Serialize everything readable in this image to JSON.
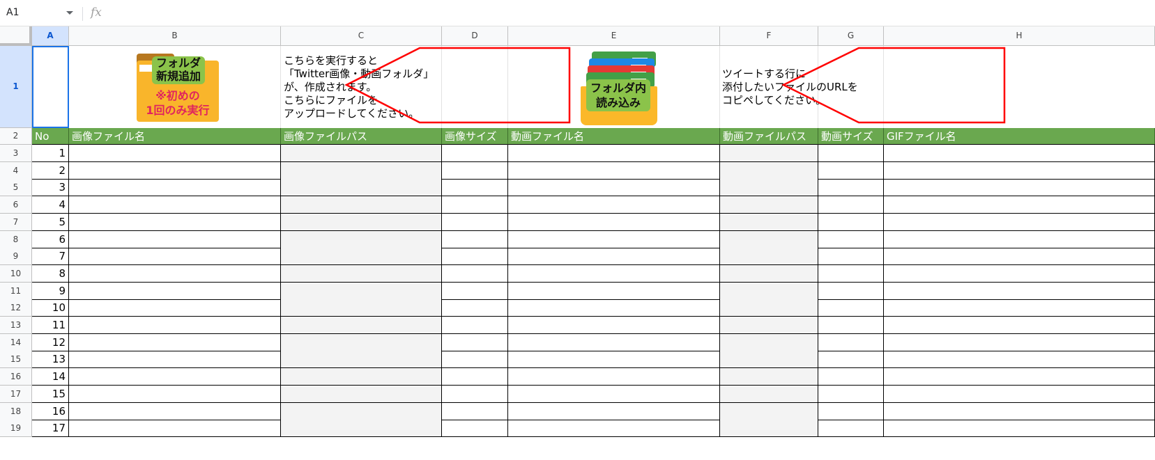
{
  "formula_bar": {
    "cell_ref": "A1",
    "fx_label": "fx"
  },
  "columns": [
    "A",
    "B",
    "C",
    "D",
    "E",
    "F",
    "G",
    "H"
  ],
  "header_row": {
    "no": "No",
    "image_file_name": "画像ファイル名",
    "image_file_path": "画像ファイルパス",
    "image_size": "画像サイズ",
    "video_file_name": "動画ファイル名",
    "video_file_path": "動画ファイルパス",
    "video_size": "動画サイズ",
    "gif_file_name": "GIFファイル名"
  },
  "row_numbers": [
    "1",
    "2",
    "3",
    "4",
    "5",
    "6",
    "7",
    "8",
    "9",
    "10",
    "11",
    "12",
    "13",
    "14",
    "15",
    "16",
    "17",
    "18",
    "19"
  ],
  "data_numbers": [
    "1",
    "2",
    "3",
    "4",
    "5",
    "6",
    "7",
    "8",
    "9",
    "10",
    "11",
    "12",
    "13",
    "14",
    "15",
    "16",
    "17"
  ],
  "button_new_folder": {
    "line1": "フォルダ",
    "line2": "新規追加",
    "note1": "※初めの",
    "note2": "1回のみ実行"
  },
  "desc_new_folder": [
    "こちらを実行すると",
    "「Twitter画像・動画フォルダ」",
    "が、作成されます。",
    "こちらにファイルを",
    "アップロードしてください。"
  ],
  "button_load_folder": {
    "line1": "フォルダ内",
    "line2": "読み込み"
  },
  "desc_load_folder": [
    "ツイートする行に",
    "添付したいファイルのURLを",
    "コピペしてください。"
  ],
  "colors": {
    "header_green": "#6aa84f",
    "path_column_gray": "#f3f3f3",
    "callout_red": "#ff0000",
    "selection_blue": "#1a73e8"
  }
}
